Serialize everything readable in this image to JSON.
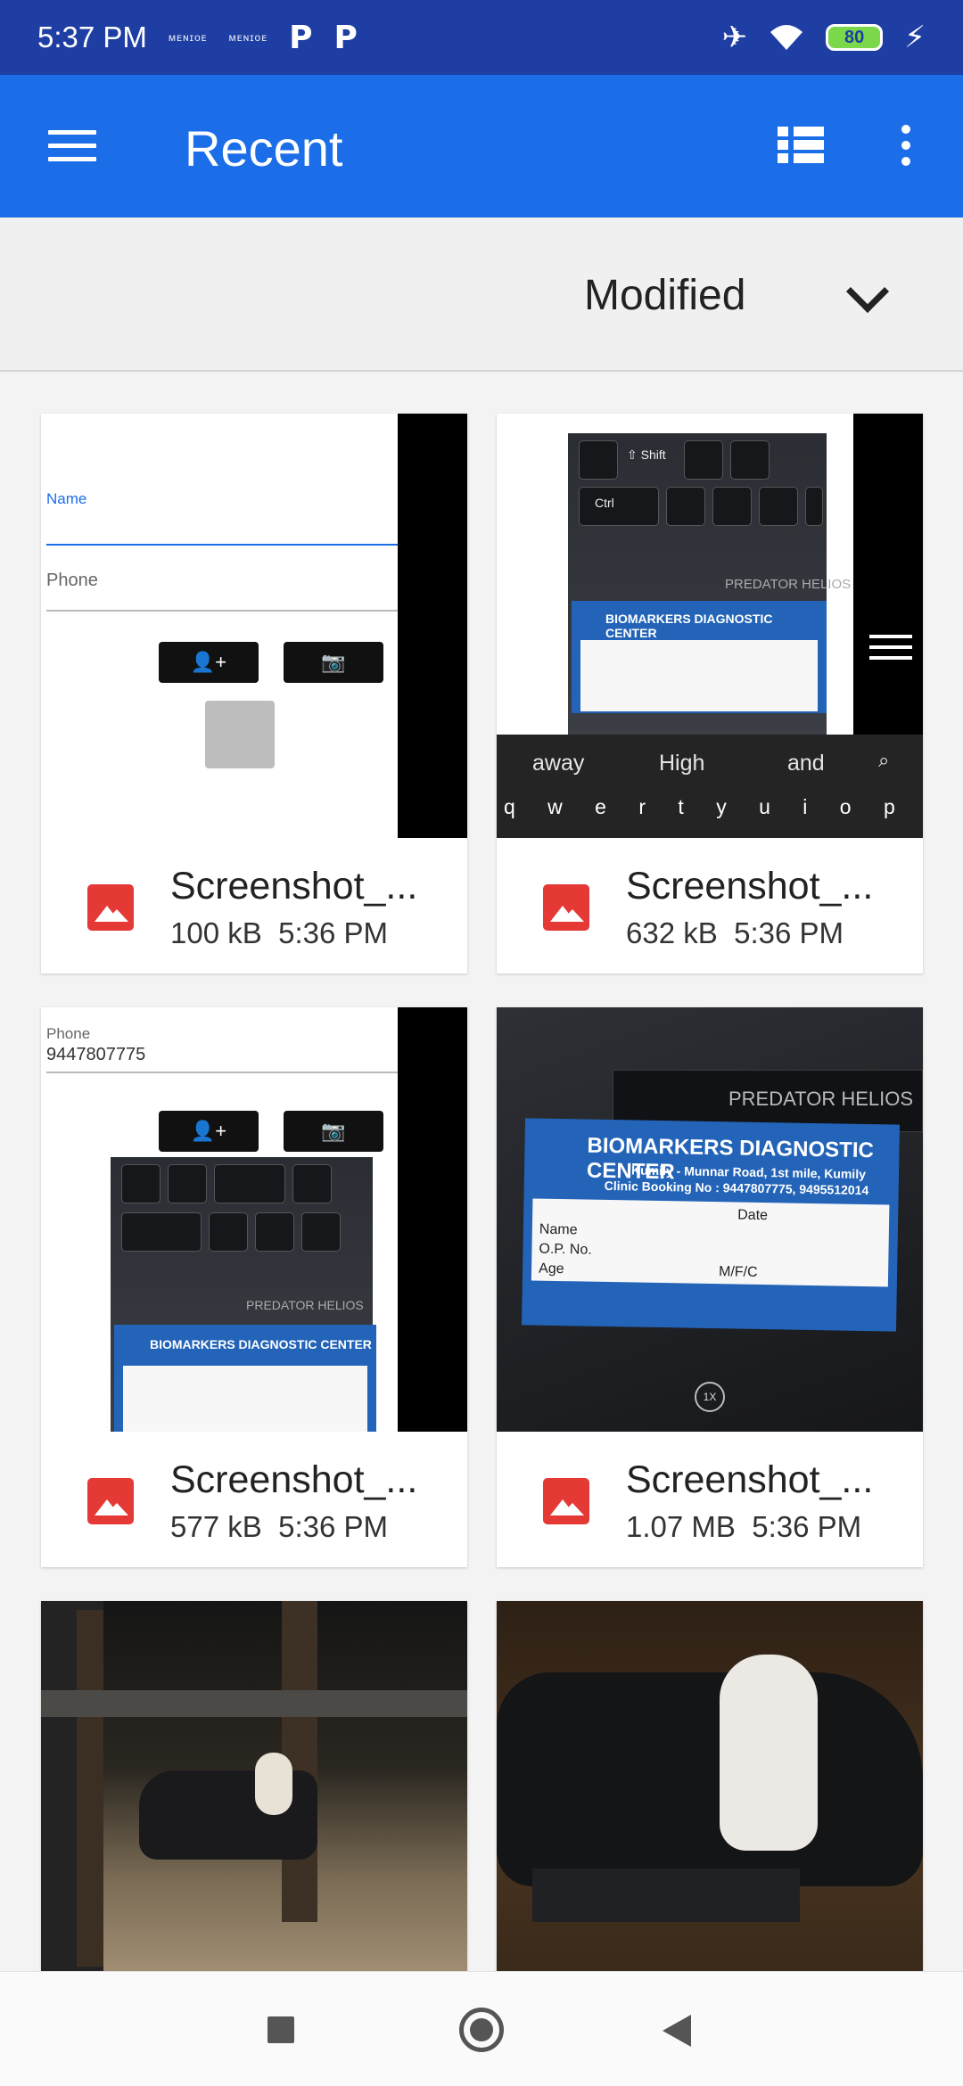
{
  "status_bar": {
    "time": "5:37 PM",
    "mini_text_1": "ᴍᴇɴɪᴏᴇ",
    "mini_text_2": "ᴍᴇɴɪᴏᴇ",
    "p1": "P",
    "p2": "P",
    "battery": "80"
  },
  "app_bar": {
    "title": "Recent"
  },
  "sort": {
    "label": "Modified"
  },
  "files": [
    {
      "name": "Screenshot_...",
      "size": "100 kB",
      "time": "5:36 PM"
    },
    {
      "name": "Screenshot_...",
      "size": "632 kB",
      "time": "5:36 PM"
    },
    {
      "name": "Screenshot_...",
      "size": "577 kB",
      "time": "5:36 PM"
    },
    {
      "name": "Screenshot_...",
      "size": "1.07 MB",
      "time": "5:36 PM"
    }
  ],
  "thumb1": {
    "name_label": "Name",
    "phone_label": "Phone"
  },
  "thumb2": {
    "suggest_1": "away",
    "suggest_2": "High",
    "suggest_3": "and",
    "keys": "q w e r t y u i o p",
    "shift": "⇧ Shift",
    "ctrl": "Ctrl",
    "brand": "PREDATOR HELIOS",
    "card_title": "BIOMARKERS DIAGNOSTIC CENTER"
  },
  "thumb3": {
    "phone_label": "Phone",
    "phone_value": "9447807775",
    "brand": "PREDATOR HELIOS",
    "card_title": "BIOMARKERS DIAGNOSTIC CENTER"
  },
  "thumb4": {
    "brand": "PREDATOR HELIOS",
    "card_title": "BIOMARKERS DIAGNOSTIC CENTER",
    "card_sub1": "Kumily - Munnar Road, 1st mile, Kumily",
    "card_sub2": "Clinic Booking No : 9447807775, 9495512014",
    "f_date": "Date",
    "f_name": "Name",
    "f_op": "O.P. No.",
    "f_age": "Age",
    "f_mfc": "M/F/C",
    "zoom": "1X"
  },
  "colors": {
    "status_bar": "#1e3ea3",
    "app_bar": "#1c6ee8",
    "file_icon": "#e53935"
  },
  "icons": {
    "menu": "menu-icon",
    "list_view": "list-view-icon",
    "overflow": "more-vert-icon",
    "sort": "chevron-down-icon",
    "file": "image-file-icon"
  }
}
